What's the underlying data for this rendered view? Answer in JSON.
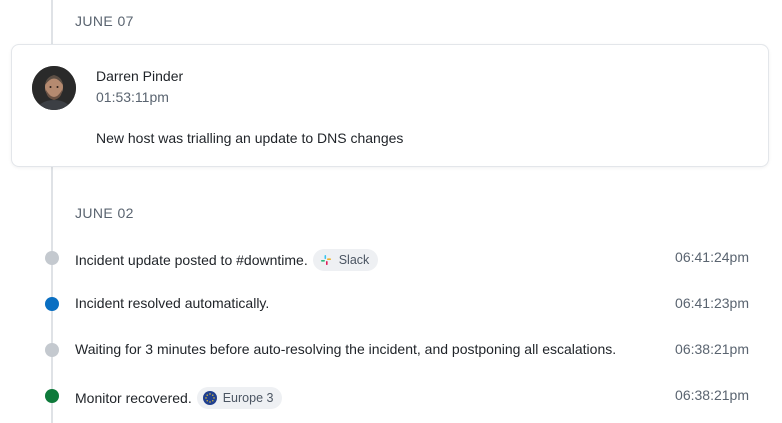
{
  "timeline": {
    "groups": [
      {
        "date": "JUNE 07",
        "comment": {
          "author": "Darren Pinder",
          "time": "01:53:11pm",
          "text": "New host was trialling an update to DNS changes"
        }
      },
      {
        "date": "JUNE 02",
        "events": [
          {
            "text": "Incident update posted to #downtime.",
            "chip": {
              "icon": "slack-icon",
              "label": "Slack"
            },
            "time": "06:41:24pm",
            "dot_color": "#c4c9cf"
          },
          {
            "text": "Incident resolved automatically.",
            "time": "06:41:23pm",
            "dot_color": "#0a6fc2"
          },
          {
            "text": "Waiting for 3 minutes before auto-resolving the incident, and postponing all escalations.",
            "time": "06:38:21pm",
            "dot_color": "#c4c9cf"
          },
          {
            "text": "Monitor recovered.",
            "chip": {
              "icon": "eu-flag-icon",
              "label": "Europe 3"
            },
            "time": "06:38:21pm",
            "dot_color": "#0e7a3b"
          }
        ]
      }
    ]
  }
}
